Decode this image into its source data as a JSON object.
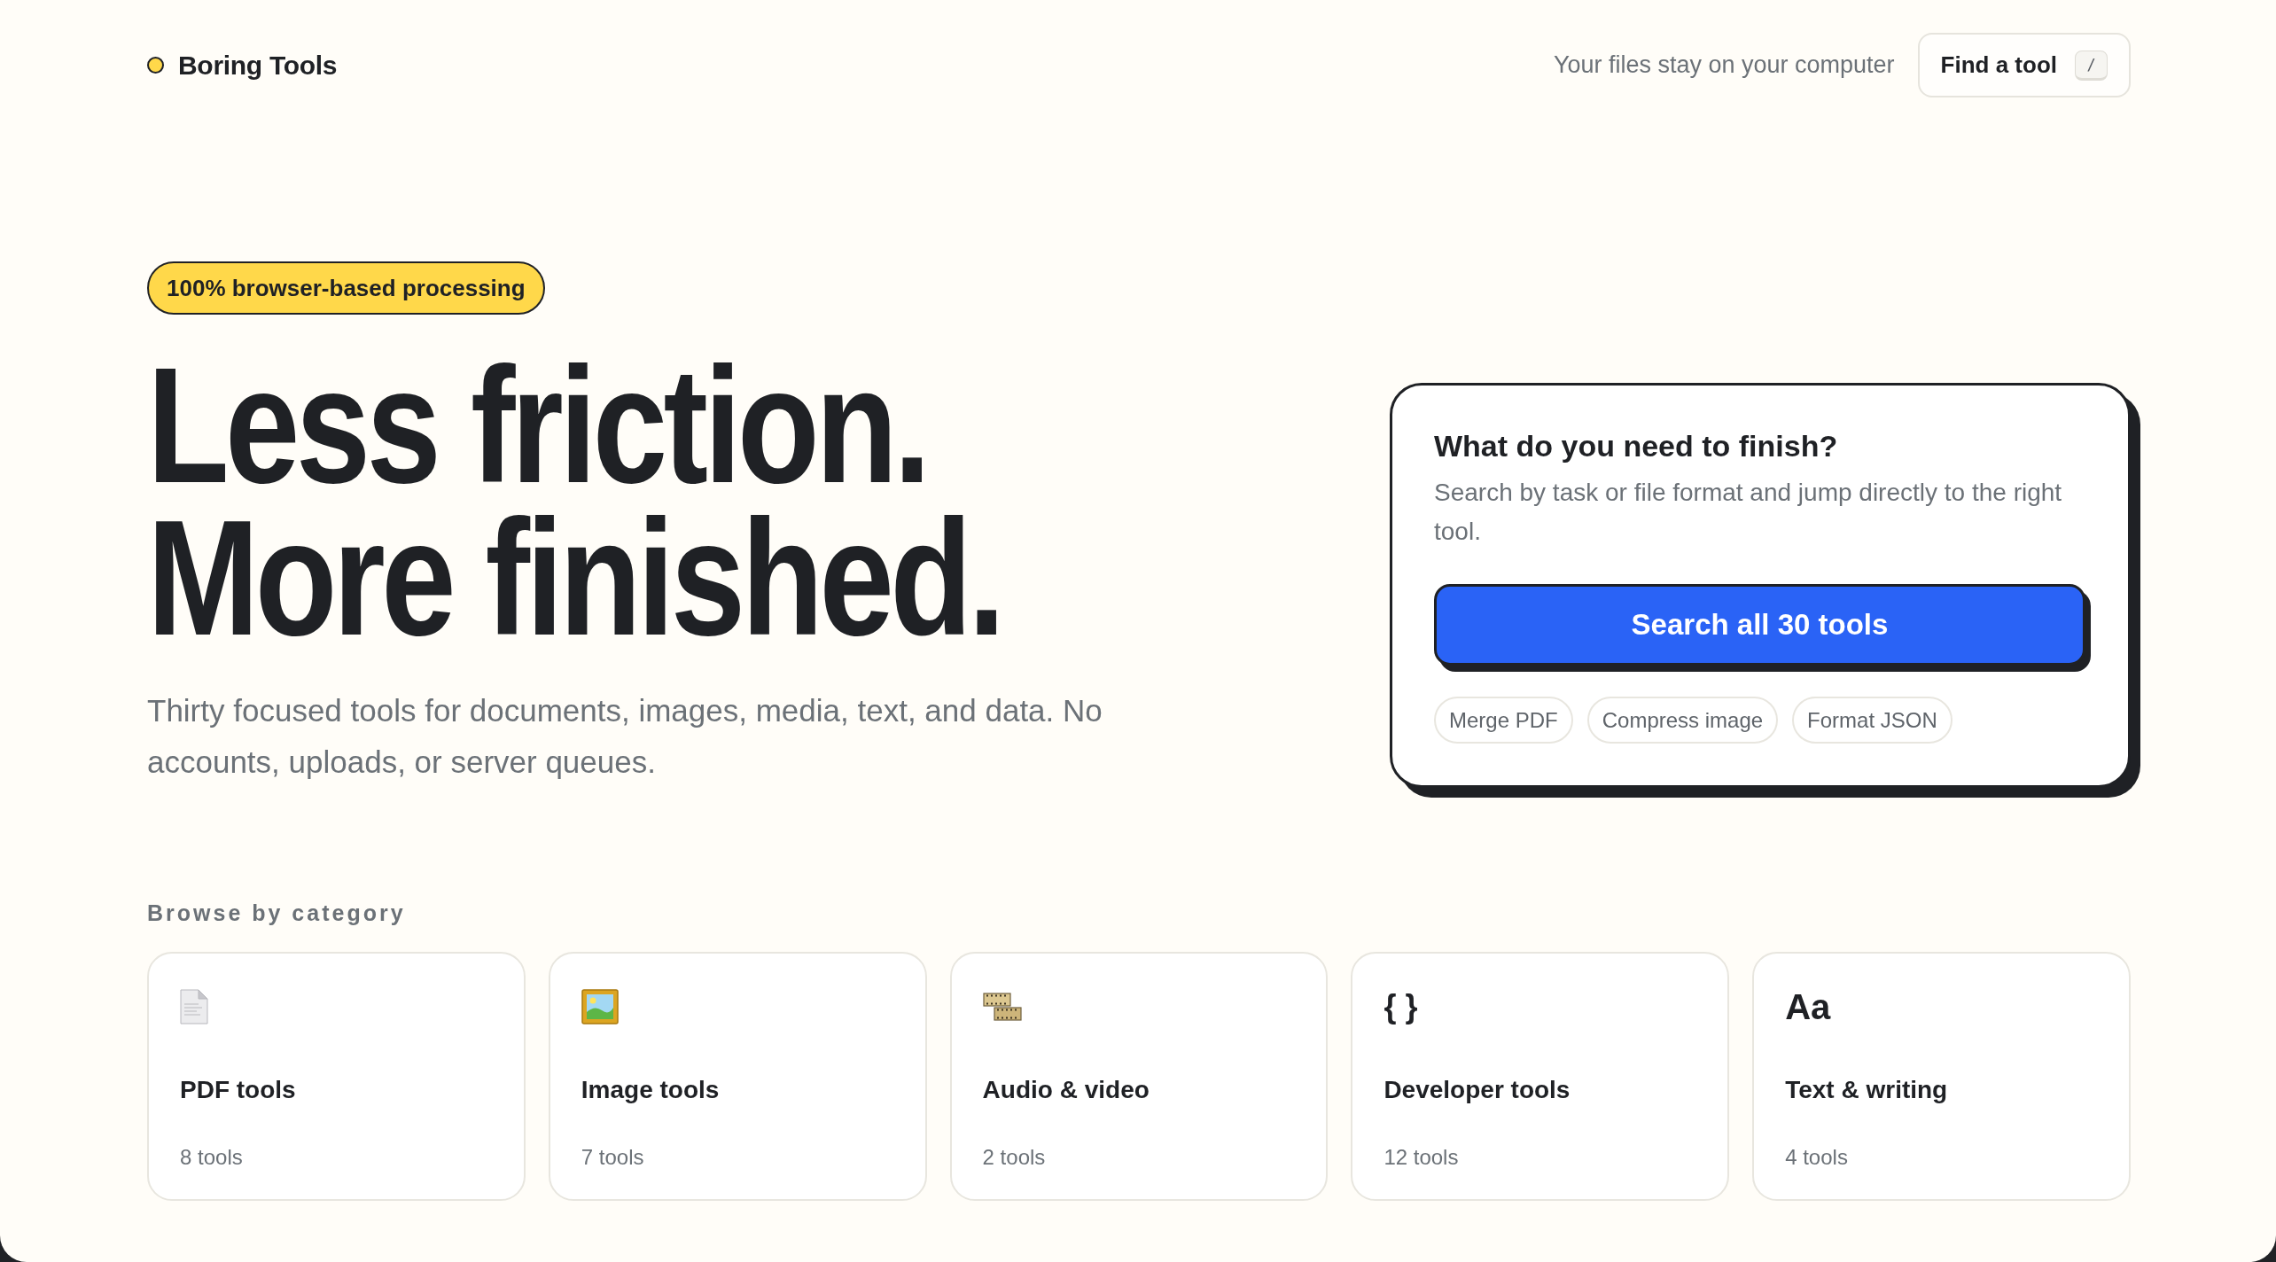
{
  "header": {
    "brand": "Boring Tools",
    "tagline": "Your files stay on your computer",
    "find_button": {
      "label": "Find a tool",
      "shortcut": "/"
    }
  },
  "hero": {
    "badge": "100% browser-based processing",
    "headline": [
      "Less friction.",
      "More finished."
    ],
    "subtitle": "Thirty focused tools for documents, images, media, text, and data. No accounts, uploads, or server queues."
  },
  "search_card": {
    "title": "What do you need to finish?",
    "description": "Search by task or file format and jump directly to the right tool.",
    "button": "Search all 30 tools",
    "suggestions": [
      "Merge PDF",
      "Compress image",
      "Format JSON"
    ]
  },
  "categories": {
    "heading": "Browse by category",
    "items": [
      {
        "kind": "pdf",
        "name": "PDF tools",
        "count": "8 tools"
      },
      {
        "kind": "image",
        "name": "Image tools",
        "count": "7 tools"
      },
      {
        "kind": "media",
        "name": "Audio & video",
        "count": "2 tools"
      },
      {
        "kind": "code",
        "glyph": "{ }",
        "name": "Developer tools",
        "count": "12 tools"
      },
      {
        "kind": "text",
        "glyph": "Aa",
        "name": "Text & writing",
        "count": "4 tools"
      }
    ]
  }
}
